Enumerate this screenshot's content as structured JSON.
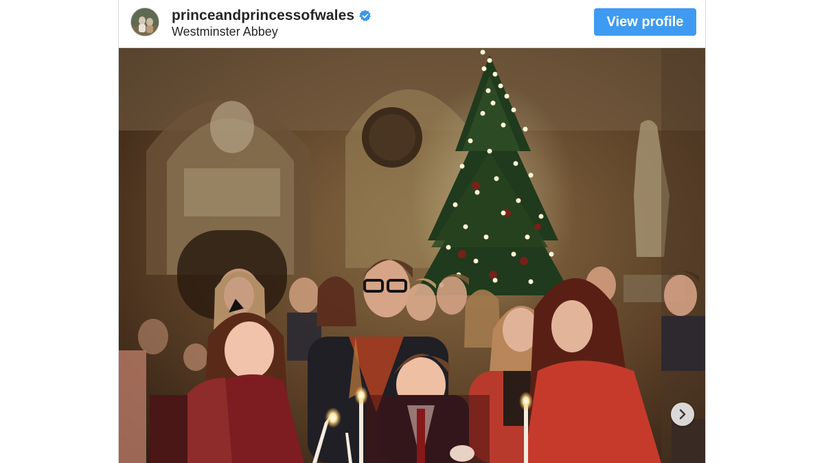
{
  "post": {
    "account": {
      "username": "princeandprincessofwales",
      "verified": true,
      "location": "Westminster Abbey",
      "avatar_icon": "profile-photo"
    },
    "actions": {
      "view_profile_label": "View profile"
    },
    "media": {
      "description_icon": "photo",
      "carousel_next_icon": "chevron-right-icon"
    }
  },
  "colors": {
    "accent": "#3f9bf1",
    "verified_badge": "#3897f0",
    "text": "#262626",
    "border": "#dbdbdb"
  }
}
